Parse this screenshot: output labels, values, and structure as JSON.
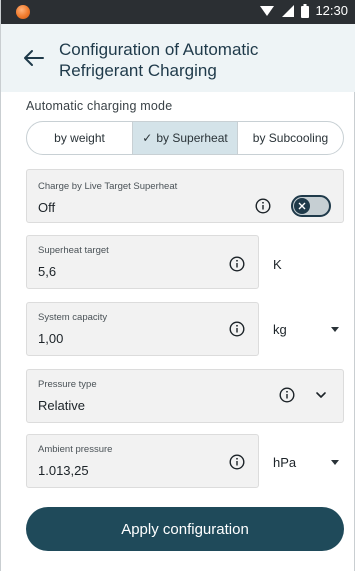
{
  "status_bar": {
    "time": "12:30",
    "icons": [
      "app-icon",
      "wifi-icon",
      "signal-icon",
      "battery-icon"
    ]
  },
  "header": {
    "title": "Configuration of Automatic Refrigerant Charging",
    "back_icon": "arrow-left-icon"
  },
  "mode": {
    "label": "Automatic charging mode",
    "options": [
      "by weight",
      "by Superheat",
      "by Subcooling"
    ],
    "selected": "by Superheat"
  },
  "live_target": {
    "label": "Charge by Live Target Superheat",
    "value": "Off",
    "toggle_on": false
  },
  "superheat_target": {
    "label": "Superheat target",
    "value": "5,6",
    "unit": "K"
  },
  "system_capacity": {
    "label": "System capacity",
    "value": "1,00",
    "unit": "kg"
  },
  "pressure_type": {
    "label": "Pressure type",
    "value": "Relative"
  },
  "ambient_pressure": {
    "label": "Ambient pressure",
    "value": "1.013,25",
    "unit": "hPa"
  },
  "apply_button": {
    "label": "Apply configuration"
  },
  "colors": {
    "status_bar": "#2b2f33",
    "header_bg": "#eef4f6",
    "primary": "#1f4a5a",
    "field_bg": "#f2f2f2",
    "selected_segment": "#d4e3e9"
  }
}
